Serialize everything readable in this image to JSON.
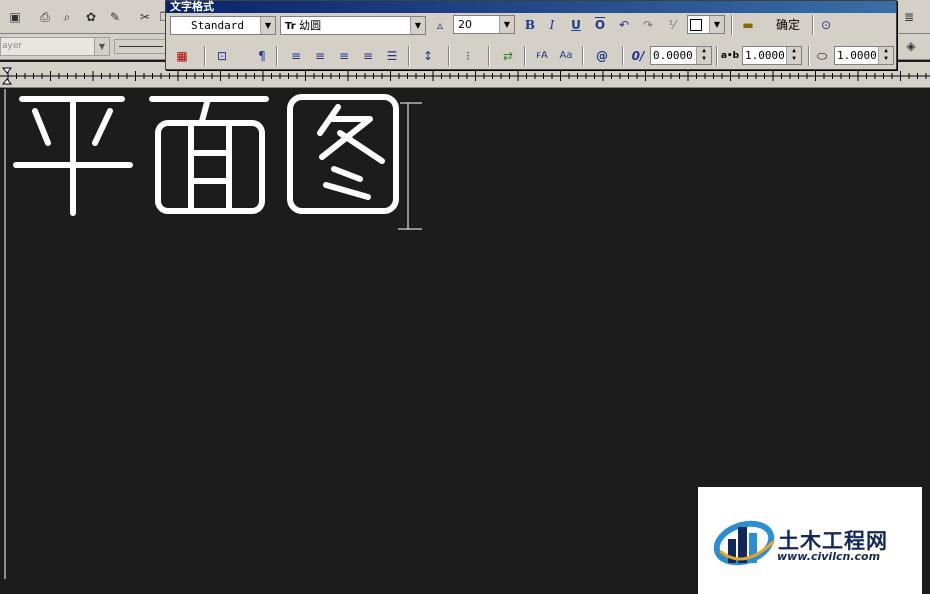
{
  "dialog": {
    "title": "文字格式",
    "style": "Standard",
    "font": "幼圆",
    "font_glyph": "Tr",
    "height": "20",
    "ok_label": "确定",
    "obliquing": "0.0000",
    "tracking": "1.0000",
    "width_factor": "1.0000",
    "tracking_prefix": "a•b",
    "oblique_prefix": "0/",
    "bold_label": "B",
    "italic_label": "I",
    "underline_label": "U",
    "overline_label": "O"
  },
  "layer": {
    "name": "ayer"
  },
  "canvas": {
    "text": [
      "平",
      "面",
      "图"
    ],
    "text_color": "#ffffff",
    "background": "#1c1c1c"
  },
  "watermark": {
    "name": "土木工程网",
    "url": "www.civilcn.com",
    "brand_color": "#12275a",
    "accent_color": "#2a8fd0"
  },
  "icons": [
    "save-icon",
    "print-icon",
    "preview-icon",
    "publish-icon",
    "plot-icon",
    "cut-icon",
    "copy-icon",
    "color-icon",
    "justify-icon",
    "paragraph-icon",
    "align-left-icon",
    "align-center-icon",
    "align-right-icon",
    "align-justify-icon",
    "distribute-icon",
    "line-spacing-icon",
    "numbering-icon",
    "insert-field-icon",
    "uppercase-icon",
    "lowercase-icon",
    "symbol-icon",
    "undo-icon",
    "redo-icon",
    "stack-icon",
    "ruler-icon",
    "options-icon"
  ]
}
